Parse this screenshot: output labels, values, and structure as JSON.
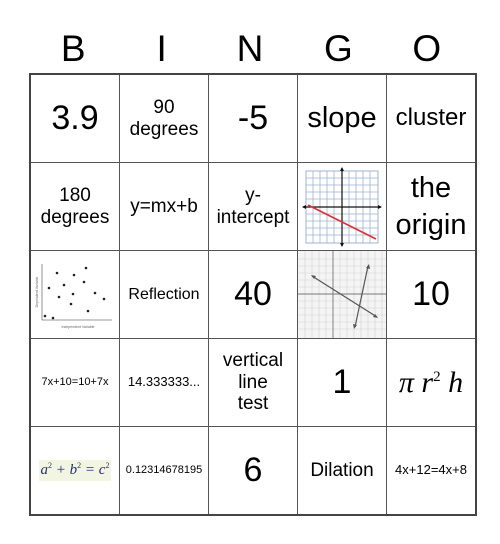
{
  "header": {
    "letters": [
      "B",
      "I",
      "N",
      "G",
      "O"
    ]
  },
  "board": {
    "rows": [
      [
        {
          "type": "text",
          "text": "3.9"
        },
        {
          "type": "text",
          "lines": [
            "90",
            "degrees"
          ]
        },
        {
          "type": "text",
          "text": "-5"
        },
        {
          "type": "text",
          "text": "slope"
        },
        {
          "type": "text",
          "text": "cluster"
        }
      ],
      [
        {
          "type": "text",
          "lines": [
            "180",
            "degrees"
          ]
        },
        {
          "type": "text",
          "text": "y=mx+b"
        },
        {
          "type": "text",
          "lines": [
            "y-",
            "intercept"
          ]
        },
        {
          "type": "image",
          "icon": "negative-slope-line-graph-icon"
        },
        {
          "type": "text",
          "lines": [
            "the",
            "origin"
          ]
        }
      ],
      [
        {
          "type": "image",
          "icon": "scatter-plot-icon",
          "xlabel": "Independent Variable",
          "ylabel": "Dependent Variable"
        },
        {
          "type": "text",
          "text": "Reflection"
        },
        {
          "type": "text",
          "text": "40"
        },
        {
          "type": "image",
          "icon": "intersecting-lines-graph-icon"
        },
        {
          "type": "text",
          "text": "10"
        }
      ],
      [
        {
          "type": "text",
          "text": "7x+10=10+7x"
        },
        {
          "type": "text",
          "text": "14.333333..."
        },
        {
          "type": "text",
          "lines": [
            "vertical",
            "line",
            "test"
          ]
        },
        {
          "type": "text",
          "text": "1"
        },
        {
          "type": "formula",
          "text": "π r² h",
          "parts": [
            "π",
            "r",
            "2",
            "h"
          ]
        }
      ],
      [
        {
          "type": "formula",
          "text": "a² + b² = c²",
          "parts": [
            "a",
            "2",
            "+",
            "b",
            "2",
            "=",
            "c",
            "2"
          ]
        },
        {
          "type": "text",
          "text": "0.12314678195"
        },
        {
          "type": "text",
          "text": "6"
        },
        {
          "type": "text",
          "text": "Dilation"
        },
        {
          "type": "text",
          "text": "4x+12=4x+8"
        }
      ]
    ]
  },
  "colors": {
    "grid_line": "#555555",
    "graph_grid": "#9db3d6",
    "graph_line": "#e03030",
    "formula_bg": "#f3f5e3",
    "formula_text": "#2a2f6a"
  }
}
